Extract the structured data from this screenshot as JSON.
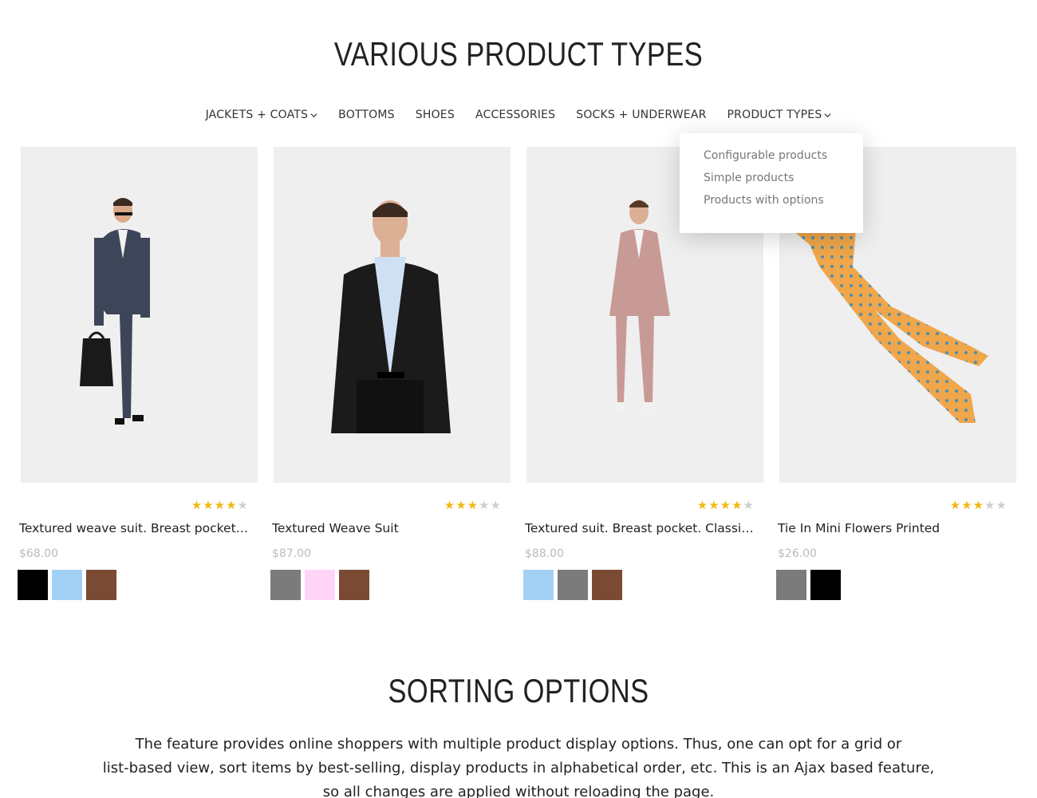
{
  "section1": {
    "title": "VARIOUS PRODUCT TYPES"
  },
  "tabs": [
    {
      "label": "JACKETS + COATS",
      "has_dropdown": true
    },
    {
      "label": "BOTTOMS",
      "has_dropdown": false
    },
    {
      "label": "SHOES",
      "has_dropdown": false
    },
    {
      "label": "ACCESSORIES",
      "has_dropdown": false
    },
    {
      "label": "SOCKS + UNDERWEAR",
      "has_dropdown": false
    },
    {
      "label": "PRODUCT TYPES",
      "has_dropdown": true
    }
  ],
  "dropdown": {
    "items": [
      "Configurable products",
      "Simple products",
      "Products with options"
    ]
  },
  "products": [
    {
      "name": "Textured weave suit. Breast pocket d...",
      "price": "$68.00",
      "rating": 4,
      "swatches": [
        "#000000",
        "#a3d0f5",
        "#7b4a33"
      ]
    },
    {
      "name": "Textured Weave Suit",
      "price": "$87.00",
      "rating": 3,
      "swatches": [
        "#7b7b7b",
        "#ffd4f8",
        "#7b4a33"
      ]
    },
    {
      "name": "Textured suit. Breast pocket. Classic ...",
      "price": "$88.00",
      "rating": 4,
      "swatches": [
        "#a3d0f5",
        "#7b7b7b",
        "#7b4a33"
      ]
    },
    {
      "name": "Tie In Mini Flowers Printed",
      "price": "$26.00",
      "rating": 3,
      "swatches": [
        "#7b7b7b",
        "#000000"
      ]
    }
  ],
  "section2": {
    "title": "SORTING OPTIONS",
    "description_lines": [
      "The feature provides online shoppers with multiple product display options. Thus, one can opt for a grid or",
      "list-based view, sort items by best-selling, display products in alphabetical order, etc. This is an Ajax based feature,",
      "so all changes are applied without reloading the page."
    ]
  },
  "colors": {
    "star_on": "#f2b814",
    "star_off": "#cfcfcf",
    "image_bg": "#efefef"
  }
}
